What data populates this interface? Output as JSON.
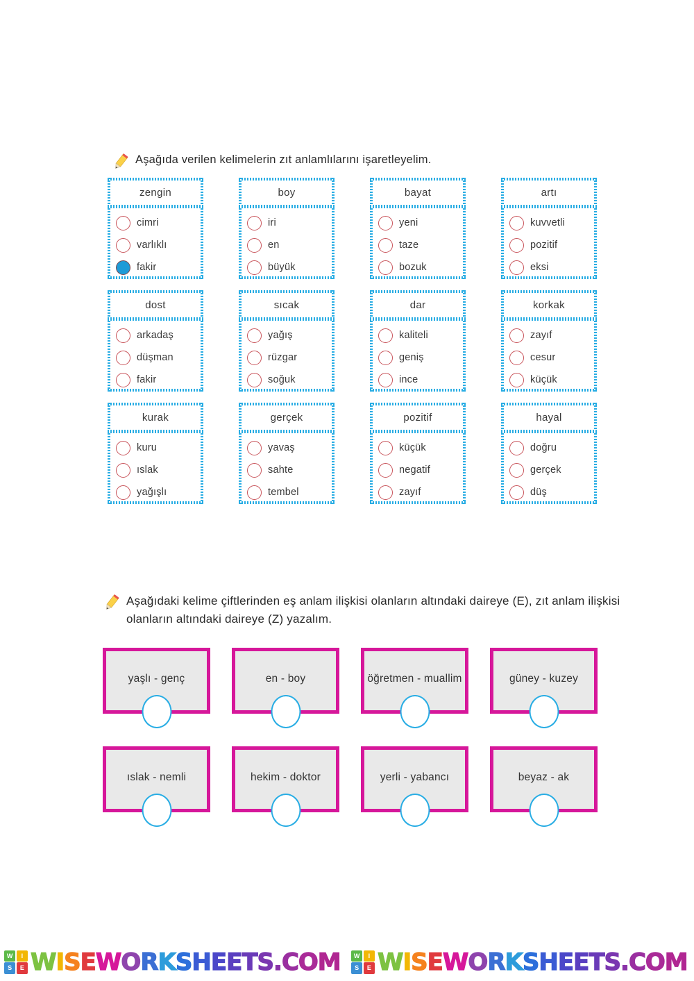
{
  "worksheet": {
    "instruction_1": "Aşağıda verilen kelimelerin zıt anlamlılarını işaretleyelim.",
    "instruction_2": "Aşağıdaki kelime çiftlerinden eş anlam ilişkisi olanların altındaki daireye (E), zıt anlam ilişkisi olanların altındaki daireye (Z) yazalım."
  },
  "colors": {
    "card_border": "#29ADE4",
    "radio_outline": "#C9555C",
    "radio_selected": "#1E9BD7",
    "pair_border": "#D6179A",
    "pair_fill": "#E9E9E9",
    "circle_outline": "#29ADE4"
  },
  "cards": [
    {
      "word": "zengin",
      "options": [
        {
          "label": "cimri",
          "selected": false
        },
        {
          "label": "varlıklı",
          "selected": false
        },
        {
          "label": "fakir",
          "selected": true
        }
      ]
    },
    {
      "word": "boy",
      "options": [
        {
          "label": "iri",
          "selected": false
        },
        {
          "label": "en",
          "selected": false
        },
        {
          "label": "büyük",
          "selected": false
        }
      ]
    },
    {
      "word": "bayat",
      "options": [
        {
          "label": "yeni",
          "selected": false
        },
        {
          "label": "taze",
          "selected": false
        },
        {
          "label": "bozuk",
          "selected": false
        }
      ]
    },
    {
      "word": "artı",
      "options": [
        {
          "label": "kuvvetli",
          "selected": false
        },
        {
          "label": "pozitif",
          "selected": false
        },
        {
          "label": "eksi",
          "selected": false
        }
      ]
    },
    {
      "word": "dost",
      "options": [
        {
          "label": "arkadaş",
          "selected": false
        },
        {
          "label": "düşman",
          "selected": false
        },
        {
          "label": "fakir",
          "selected": false
        }
      ]
    },
    {
      "word": "sıcak",
      "options": [
        {
          "label": "yağış",
          "selected": false
        },
        {
          "label": "rüzgar",
          "selected": false
        },
        {
          "label": "soğuk",
          "selected": false
        }
      ]
    },
    {
      "word": "dar",
      "options": [
        {
          "label": "kaliteli",
          "selected": false
        },
        {
          "label": "geniş",
          "selected": false
        },
        {
          "label": "ince",
          "selected": false
        }
      ]
    },
    {
      "word": "korkak",
      "options": [
        {
          "label": "zayıf",
          "selected": false
        },
        {
          "label": "cesur",
          "selected": false
        },
        {
          "label": "küçük",
          "selected": false
        }
      ]
    },
    {
      "word": "kurak",
      "options": [
        {
          "label": "kuru",
          "selected": false
        },
        {
          "label": "ıslak",
          "selected": false
        },
        {
          "label": "yağışlı",
          "selected": false
        }
      ]
    },
    {
      "word": "gerçek",
      "options": [
        {
          "label": "yavaş",
          "selected": false
        },
        {
          "label": "sahte",
          "selected": false
        },
        {
          "label": "tembel",
          "selected": false
        }
      ]
    },
    {
      "word": "pozitif",
      "options": [
        {
          "label": "küçük",
          "selected": false
        },
        {
          "label": "negatif",
          "selected": false
        },
        {
          "label": "zayıf",
          "selected": false
        }
      ]
    },
    {
      "word": "hayal",
      "options": [
        {
          "label": "doğru",
          "selected": false
        },
        {
          "label": "gerçek",
          "selected": false
        },
        {
          "label": "düş",
          "selected": false
        }
      ]
    }
  ],
  "word_pairs": [
    {
      "text": "yaşlı - genç",
      "answer": ""
    },
    {
      "text": "en - boy",
      "answer": ""
    },
    {
      "text": "öğretmen - muallim",
      "answer": ""
    },
    {
      "text": "güney - kuzey",
      "answer": ""
    },
    {
      "text": "ıslak - nemli",
      "answer": ""
    },
    {
      "text": "hekim - doktor",
      "answer": ""
    },
    {
      "text": "yerli - yabancı",
      "answer": ""
    },
    {
      "text": "beyaz - ak",
      "answer": ""
    }
  ],
  "footer": {
    "watermark_text": "WISEWORKSHEETS.COM",
    "logo_letters": [
      "W",
      "I",
      "S",
      "E"
    ],
    "repetitions": 2
  }
}
